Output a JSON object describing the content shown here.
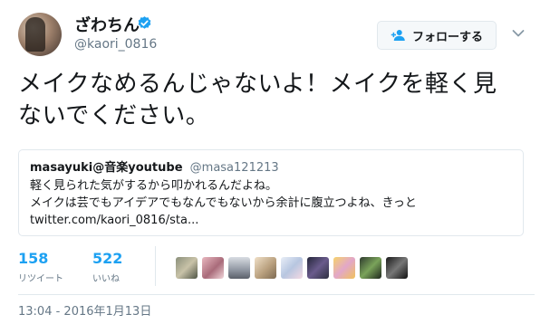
{
  "author": {
    "name": "ざわちん",
    "handle": "@kaori_0816",
    "verified": true,
    "verified_icon": "verified-badge-icon",
    "verified_color": "#1da1f2"
  },
  "follow_button": {
    "label": "フォローする",
    "icon": "follow-user-icon"
  },
  "menu_icon": "chevron-down-icon",
  "tweet": {
    "lines": [
      "メイクなめるんじゃないよ！メイクを軽く見",
      "ないでください。"
    ]
  },
  "quote": {
    "name": "masayuki@音楽youtube",
    "handle": "@masa121213",
    "lines": [
      "軽く見られた気がするから叩かれるんだよね。",
      "メイクは芸でもアイデアでもなんでもないから余計に腹立つよね、きっと",
      "twitter.com/kaori_0816/sta..."
    ]
  },
  "stats": {
    "retweets": {
      "count": "158",
      "label": "リツイート"
    },
    "likes": {
      "count": "522",
      "label": "いいね"
    },
    "accent_color": "#1da1f2"
  },
  "liker_avatars_count": 9,
  "timestamp": "13:04 - 2016年1月13日"
}
